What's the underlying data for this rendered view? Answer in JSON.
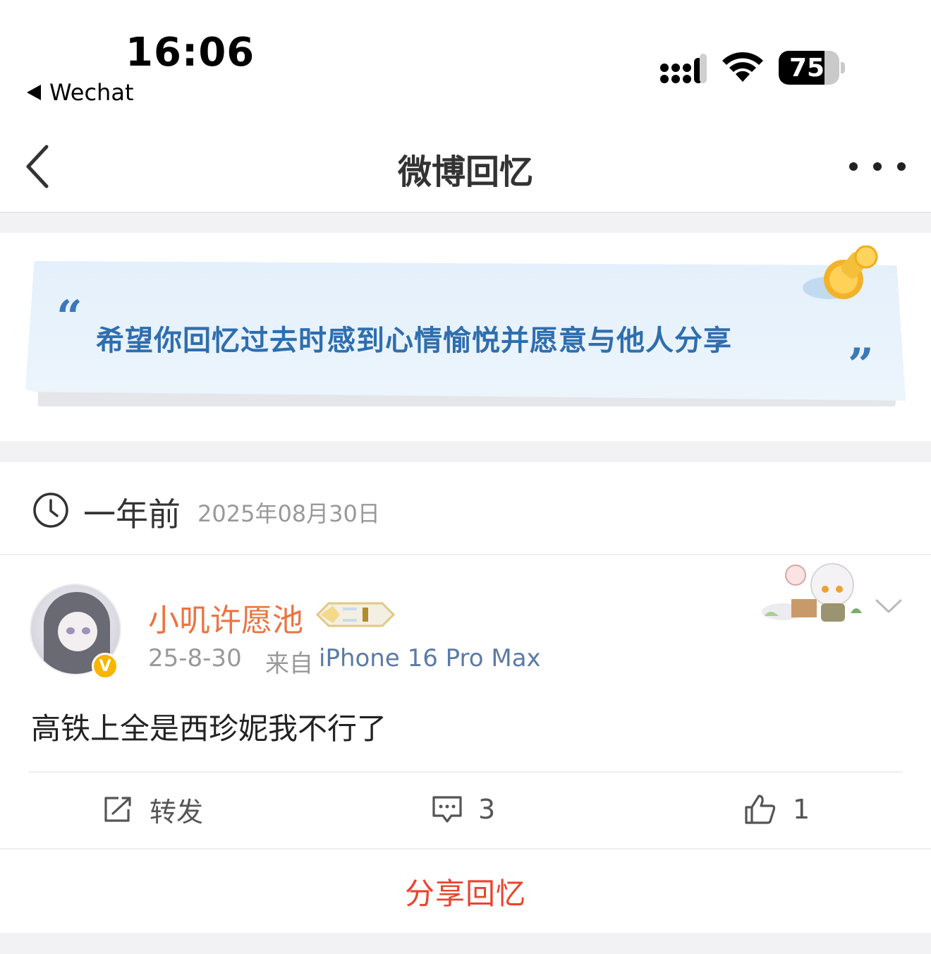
{
  "status_bar": {
    "time": "16:06",
    "back_app": "Wechat",
    "battery_level": 75,
    "battery_label": "75"
  },
  "nav": {
    "title": "微博回忆",
    "back_icon": "chevron-left-icon",
    "more_icon": "more-dots-icon"
  },
  "banner": {
    "quote_open": "“",
    "text": "希望你回忆过去时感到心情愉悦并愿意与他人分享",
    "quote_close": "”"
  },
  "memory": {
    "label": "一年前",
    "date": "2025年08月30日"
  },
  "post": {
    "username": "小叽许愿池",
    "time": "25-8-30",
    "from_label": "来自",
    "device": "iPhone 16 Pro Max",
    "text": "高铁上全是西珍妮我不行了",
    "verified_badge": "V"
  },
  "actions": {
    "repost_label": "转发",
    "comment_count": "3",
    "like_count": "1"
  },
  "share": {
    "label": "分享回忆"
  },
  "colors": {
    "username": "#eb7340",
    "device_link": "#5b7ba6",
    "share": "#e8452f",
    "banner_text": "#2f6eae",
    "verified": "#f7b500"
  }
}
